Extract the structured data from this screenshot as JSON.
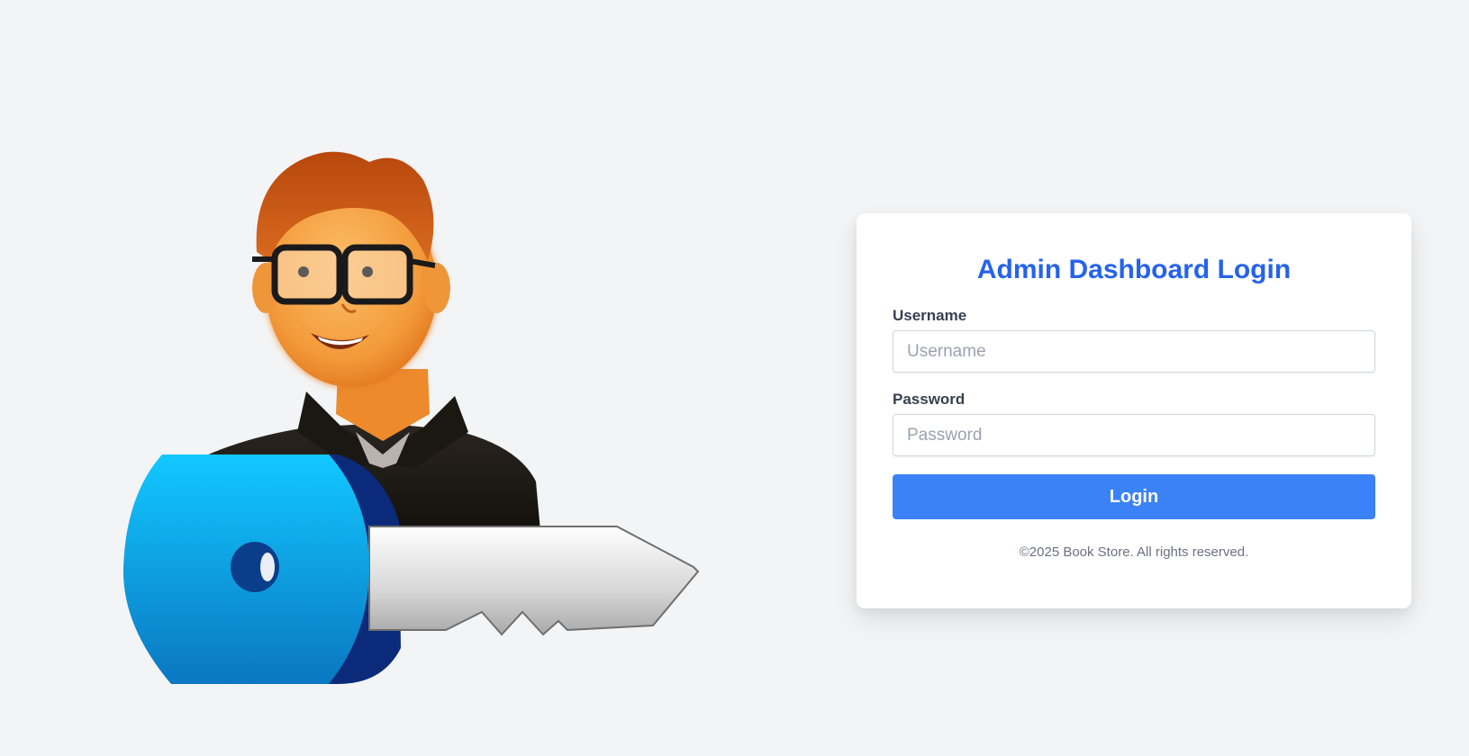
{
  "login": {
    "title": "Admin Dashboard Login",
    "username_label": "Username",
    "username_placeholder": "Username",
    "username_value": "",
    "password_label": "Password",
    "password_placeholder": "Password",
    "password_value": "",
    "button_label": "Login",
    "footer": "©2025 Book Store. All rights reserved."
  },
  "illustration": {
    "icon": "admin-with-key-icon"
  },
  "colors": {
    "accent": "#2563eb",
    "button": "#3b82f6",
    "background": "#f3f4f6",
    "card": "#ffffff"
  }
}
